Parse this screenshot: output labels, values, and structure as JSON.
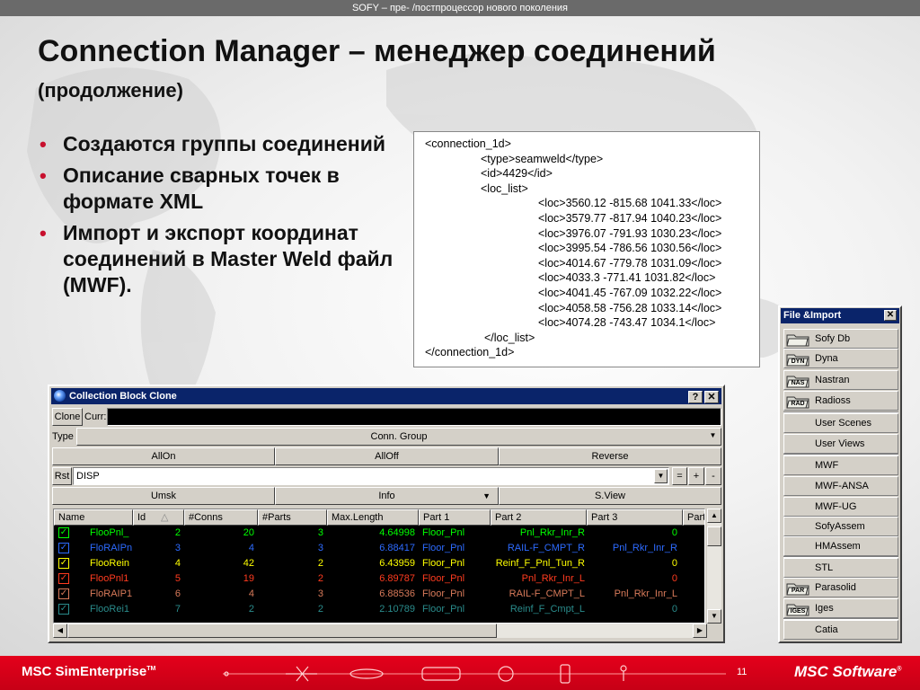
{
  "header": {
    "text": "SOFY – пре- /постпроцессор нового поколения"
  },
  "slide": {
    "title": "Connection Manager – менеджер соединений",
    "subtitle": "(продолжение)",
    "bullets": [
      "Создаются группы соединений",
      "Описание сварных точек в формате XML",
      "Импорт и экспорт координат соединений в Master Weld файл (MWF)."
    ]
  },
  "xml_lines": [
    "<connection_1d>",
    "<type>seamweld</type>",
    "<id>4429</id>",
    "<loc_list>",
    "<loc>3560.12 -815.68 1041.33</loc>",
    "<loc>3579.77 -817.94 1040.23</loc>",
    "<loc>3976.07 -791.93 1030.23</loc>",
    "<loc>3995.54 -786.56 1030.56</loc>",
    "<loc>4014.67 -779.78 1031.09</loc>",
    "<loc>4033.3 -771.41 1031.82</loc>",
    "<loc>4041.45 -767.09 1032.22</loc>",
    "<loc>4058.58 -756.28 1033.14</loc>",
    "<loc>4074.28 -743.47 1034.1</loc>",
    "</loc_list>",
    "</connection_1d>"
  ],
  "dialog": {
    "title": "Collection Block Clone",
    "help_label": "?",
    "close_label": "✕",
    "clone_label": "Clone",
    "curr_label": "Curr:",
    "type_label": "Type",
    "type_value": "Conn. Group",
    "allon_label": "AllOn",
    "alloff_label": "AllOff",
    "reverse_label": "Reverse",
    "rst_label": "Rst",
    "rst_value": "DISP",
    "eq_label": "=",
    "plus_label": "+",
    "minus_label": "-",
    "umsk_label": "Umsk",
    "info_label": "Info",
    "sview_label": "S.View",
    "columns": [
      "Name",
      "Id",
      "#Conns",
      "#Parts",
      "Max.Length",
      "Part 1",
      "Part 2",
      "Part 3",
      "Part"
    ],
    "rows": [
      {
        "name": "FlooPnl_",
        "id": "2",
        "conns": "20",
        "parts": "3",
        "maxlen": "4.64998",
        "p1": "Floor_Pnl",
        "p2": "Pnl_Rkr_Inr_R",
        "p3": "0",
        "color": "#00ff00"
      },
      {
        "name": "FloRAIPn",
        "id": "3",
        "conns": "4",
        "parts": "3",
        "maxlen": "6.88417",
        "p1": "Floor_Pnl",
        "p2": "RAIL-F_CMPT_R",
        "p3": "Pnl_Rkr_Inr_R",
        "color": "#2d6bff"
      },
      {
        "name": "FlooRein",
        "id": "4",
        "conns": "42",
        "parts": "2",
        "maxlen": "6.43959",
        "p1": "Floor_Pnl",
        "p2": "Reinf_F_Pnl_Tun_R",
        "p3": "0",
        "color": "#ffff00"
      },
      {
        "name": "FlooPnl1",
        "id": "5",
        "conns": "19",
        "parts": "2",
        "maxlen": "6.89787",
        "p1": "Floor_Pnl",
        "p2": "Pnl_Rkr_Inr_L",
        "p3": "0",
        "color": "#ff3b1f"
      },
      {
        "name": "FloRAIP1",
        "id": "6",
        "conns": "4",
        "parts": "3",
        "maxlen": "6.88536",
        "p1": "Floor_Pnl",
        "p2": "RAIL-F_CMPT_L",
        "p3": "Pnl_Rkr_Inr_L",
        "color": "#d87a5a"
      },
      {
        "name": "FlooRei1",
        "id": "7",
        "conns": "2",
        "parts": "2",
        "maxlen": "2.10789",
        "p1": "Floor_Pnl",
        "p2": "Reinf_F_Cmpt_L",
        "p3": "0",
        "color": "#2a8c8c"
      }
    ]
  },
  "panel": {
    "title": "File &Import",
    "close_label": "✕",
    "items": [
      {
        "label": "Sofy Db",
        "icon": ""
      },
      {
        "label": "Dyna",
        "icon": "DYN"
      },
      {
        "label": "Nastran",
        "icon": "NAS"
      },
      {
        "label": "Radioss",
        "icon": "RAD"
      },
      {
        "label": "User Scenes",
        "icon": ""
      },
      {
        "label": "User Views",
        "icon": ""
      },
      {
        "label": "MWF",
        "icon": ""
      },
      {
        "label": "MWF-ANSA",
        "icon": ""
      },
      {
        "label": "MWF-UG",
        "icon": ""
      },
      {
        "label": "SofyAssem",
        "icon": ""
      },
      {
        "label": "HMAssem",
        "icon": ""
      },
      {
        "label": "STL",
        "icon": ""
      },
      {
        "label": "Parasolid",
        "icon": "PAR"
      },
      {
        "label": "Iges",
        "icon": "IGES"
      },
      {
        "label": "Catia",
        "icon": ""
      }
    ]
  },
  "footer": {
    "left_brand": "MSC SimEnterprise",
    "left_tm": "TM",
    "page_number": "11",
    "right_brand": "MSC Software",
    "right_tm": "®"
  },
  "colors": {
    "accent_red": "#e4001b",
    "titlebar_blue": "#0a246a",
    "bullet_red": "#c8102e"
  }
}
